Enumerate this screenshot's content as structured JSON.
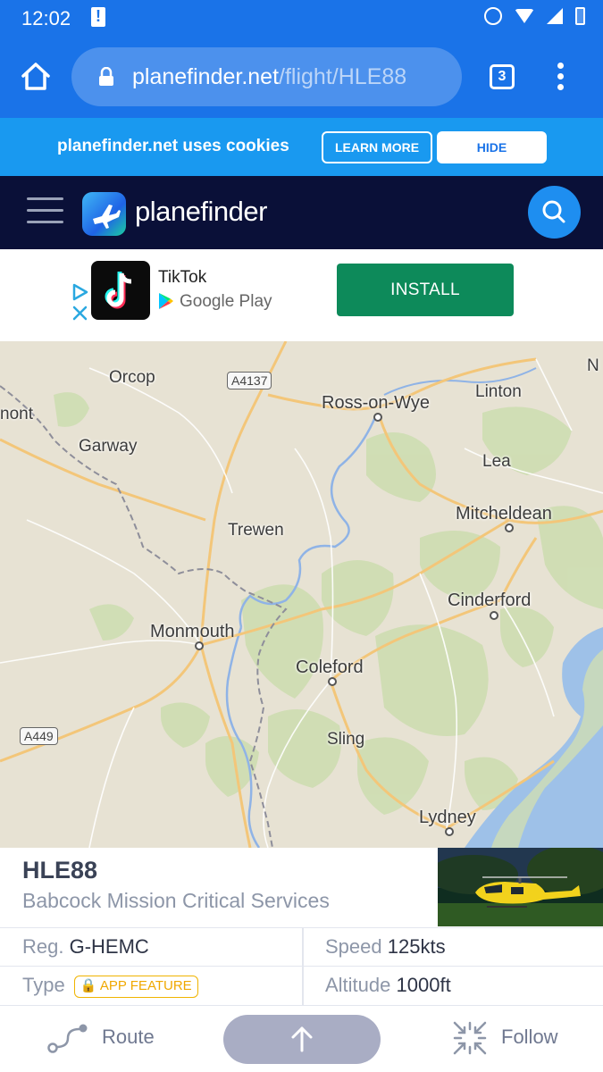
{
  "status_bar": {
    "time": "12:02"
  },
  "browser": {
    "url_domain": "planefinder.net",
    "url_path": "/flight/HLE88",
    "tab_count": "3"
  },
  "cookie_banner": {
    "text": "planefinder.net uses cookies",
    "learn_more": "LEARN MORE",
    "hide": "HIDE"
  },
  "site_header": {
    "logo_text": "planefinder"
  },
  "ad": {
    "title": "TikTok",
    "store": "Google Play",
    "install": "INSTALL"
  },
  "map": {
    "places": [
      {
        "name": "Orcop",
        "id": "orcop"
      },
      {
        "name": "Ross-on-Wye",
        "id": "ross"
      },
      {
        "name": "Linton",
        "id": "linton"
      },
      {
        "name": "nont",
        "id": "nont"
      },
      {
        "name": "Garway",
        "id": "garway"
      },
      {
        "name": "Lea",
        "id": "lea"
      },
      {
        "name": "Mitcheldean",
        "id": "mitcheldean"
      },
      {
        "name": "Trewen",
        "id": "trewen"
      },
      {
        "name": "Cinderford",
        "id": "cinderford"
      },
      {
        "name": "Monmouth",
        "id": "monmouth"
      },
      {
        "name": "Coleford",
        "id": "coleford"
      },
      {
        "name": "Sling",
        "id": "sling"
      },
      {
        "name": "Lydney",
        "id": "lydney"
      },
      {
        "name": "N",
        "id": "n-edge"
      }
    ],
    "roads": [
      "A4137",
      "A449"
    ]
  },
  "flight": {
    "callsign": "HLE88",
    "operator": "Babcock Mission Critical Services",
    "reg_label": "Reg.",
    "reg_value": "G-HEMC",
    "speed_label": "Speed",
    "speed_value": "125kts",
    "type_label": "Type",
    "type_badge": "APP FEATURE",
    "altitude_label": "Altitude",
    "altitude_value": "1000ft"
  },
  "bottom_bar": {
    "route": "Route",
    "follow": "Follow"
  },
  "colors": {
    "chrome_blue": "#1a73e8",
    "cookie_blue": "#1999f0",
    "header_navy": "#0a1038",
    "install_green": "#0d8a5a",
    "badge_amber": "#f0a800"
  }
}
